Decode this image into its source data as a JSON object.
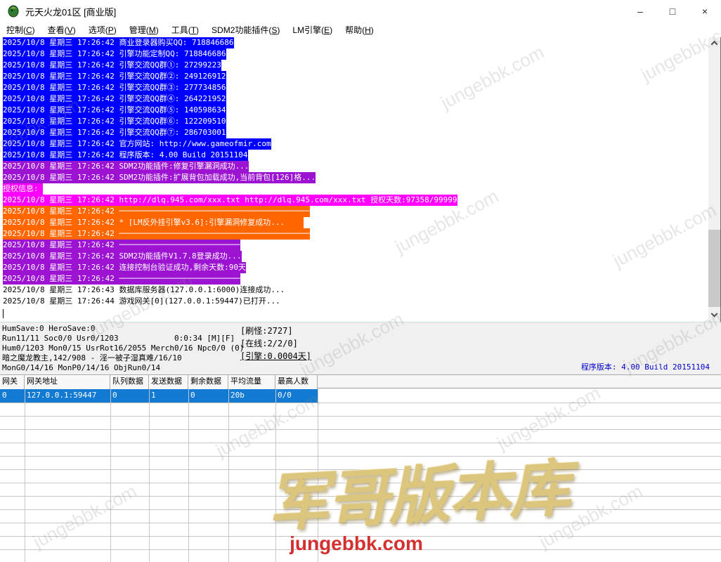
{
  "window": {
    "title": "元天火龙01区 [商业版]",
    "minimize_label": "–",
    "maximize_label": "□",
    "close_label": "×"
  },
  "menu_bar": {
    "items": [
      {
        "pre": "控制(",
        "key": "C",
        "post": ")"
      },
      {
        "pre": "查看(",
        "key": "V",
        "post": ")"
      },
      {
        "pre": "选项(",
        "key": "P",
        "post": ")"
      },
      {
        "pre": "管理(",
        "key": "M",
        "post": ")"
      },
      {
        "pre": "工具(",
        "key": "T",
        "post": ")"
      },
      {
        "pre": "SDM2功能插件(",
        "key": "S",
        "post": ")"
      },
      {
        "pre": "LM引擎(",
        "key": "E",
        "post": ")"
      },
      {
        "pre": "帮助(",
        "key": "H",
        "post": ")"
      }
    ]
  },
  "log_panel": {
    "lines": [
      {
        "text": "2025/10/8 星期三 17:26:42 商业登录器购买QQ: 718846686",
        "style": "blue"
      },
      {
        "text": "2025/10/8 星期三 17:26:42 引擎功能定制QQ: 718846686",
        "style": "blue"
      },
      {
        "text": "2025/10/8 星期三 17:26:42 引擎交流QQ群①: 27299223",
        "style": "blue"
      },
      {
        "text": "2025/10/8 星期三 17:26:42 引擎交流QQ群②: 249126912",
        "style": "blue"
      },
      {
        "text": "2025/10/8 星期三 17:26:42 引擎交流QQ群③: 277734856",
        "style": "blue"
      },
      {
        "text": "2025/10/8 星期三 17:26:42 引擎交流QQ群④: 264221952",
        "style": "blue"
      },
      {
        "text": "2025/10/8 星期三 17:26:42 引擎交流QQ群⑤: 140598634",
        "style": "blue"
      },
      {
        "text": "2025/10/8 星期三 17:26:42 引擎交流QQ群⑥: 122209510",
        "style": "blue"
      },
      {
        "text": "2025/10/8 星期三 17:26:42 引擎交流QQ群⑦: 286703001",
        "style": "blue"
      },
      {
        "text": "2025/10/8 星期三 17:26:42 官方网站: http://www.gameofmir.com",
        "style": "blue"
      },
      {
        "text": "2025/10/8 星期三 17:26:42 程序版本: 4.00 Build 20151104",
        "style": "blue"
      },
      {
        "text": "2025/10/8 星期三 17:26:42 SDM2功能插件:修复引擎漏洞成功...",
        "style": "purple"
      },
      {
        "text": "2025/10/8 星期三 17:26:42 SDM2功能插件:扩展背包加载成功,当前背包[126]格...",
        "style": "purple"
      },
      {
        "text": "授权信息: ",
        "style": "magenta"
      },
      {
        "text": "2025/10/8 星期三 17:26:42 http://dlq.945.com/xxx.txt http://dlq.945.com/xxx.txt 授权天数:97358/99999",
        "style": "magenta"
      },
      {
        "text": "2025/10/8 星期三 17:26:42 ─────────────────────────────────────────",
        "style": "orange"
      },
      {
        "text": "2025/10/8 星期三 17:26:42 * [LM反外挂引擎v3.6]:引擎漏洞修复成功...    ",
        "style": "orange"
      },
      {
        "text": "2025/10/8 星期三 17:26:42 ─────────────────────────────────────────",
        "style": "orange"
      },
      {
        "text": "2025/10/8 星期三 17:26:42 ──────────────────────────",
        "style": "purple"
      },
      {
        "text": "2025/10/8 星期三 17:26:42 SDM2功能插件V1.7.8登录成功...",
        "style": "purple"
      },
      {
        "text": "2025/10/8 星期三 17:26:42 连接控制台验证成功,剩余天数:90天",
        "style": "purple"
      },
      {
        "text": "2025/10/8 星期三 17:26:42 ──────────────────────────",
        "style": "purple"
      },
      {
        "text": "2025/10/8 星期三 17:26:43 数据库服务器(127.0.0.1:6000)连接成功...",
        "style": "plain"
      },
      {
        "text": "2025/10/8 星期三 17:26:44 游戏网关[0](127.0.0.1:59447)已打开...",
        "style": "plain"
      }
    ]
  },
  "status_panel": {
    "left_lines": [
      "HumSave:0 HeroSave:0",
      "Run11/11 Soc0/0 Usr0/1203            0:0:34 [M][F]",
      "Hum0/1203 Mon0/15 UsrRot16/2055 Merch0/16 Npc0/0 (0)",
      "暗之魔龙教主,142/908 - 淫一被子湿真难/16/10",
      "MonG0/14/16 MonP0/14/16 ObjRun0/14"
    ],
    "counters": [
      "[刷怪:2727]",
      "[在线:2/2/0]",
      "[引擎:0.0004天]"
    ],
    "version_text": "程序版本: 4.00 Build 20151104"
  },
  "gateway_table": {
    "columns": [
      "网关",
      "网关地址",
      "队列数据",
      "发送数据",
      "剩余数据",
      "平均流量",
      "最高人数"
    ],
    "selected_row": [
      "0",
      "127.0.0.1:59447",
      "0",
      "1",
      "0",
      "20b",
      "0/0"
    ]
  },
  "watermark": {
    "diagonal_text": "jungebbk.com",
    "calligraphy_text": "军哥版本库",
    "site_url": "jungebbk.com"
  },
  "colors": {
    "log_blue": "#0000FE",
    "log_purple": "#9C14D2",
    "log_magenta": "#FF00FF",
    "log_orange": "#FF6600",
    "selected_row_blue": "#127AD2",
    "version_text_blue": "#0000CC",
    "watermark_red": "#D43030",
    "calligraphy_gold": "#DCC67E"
  }
}
